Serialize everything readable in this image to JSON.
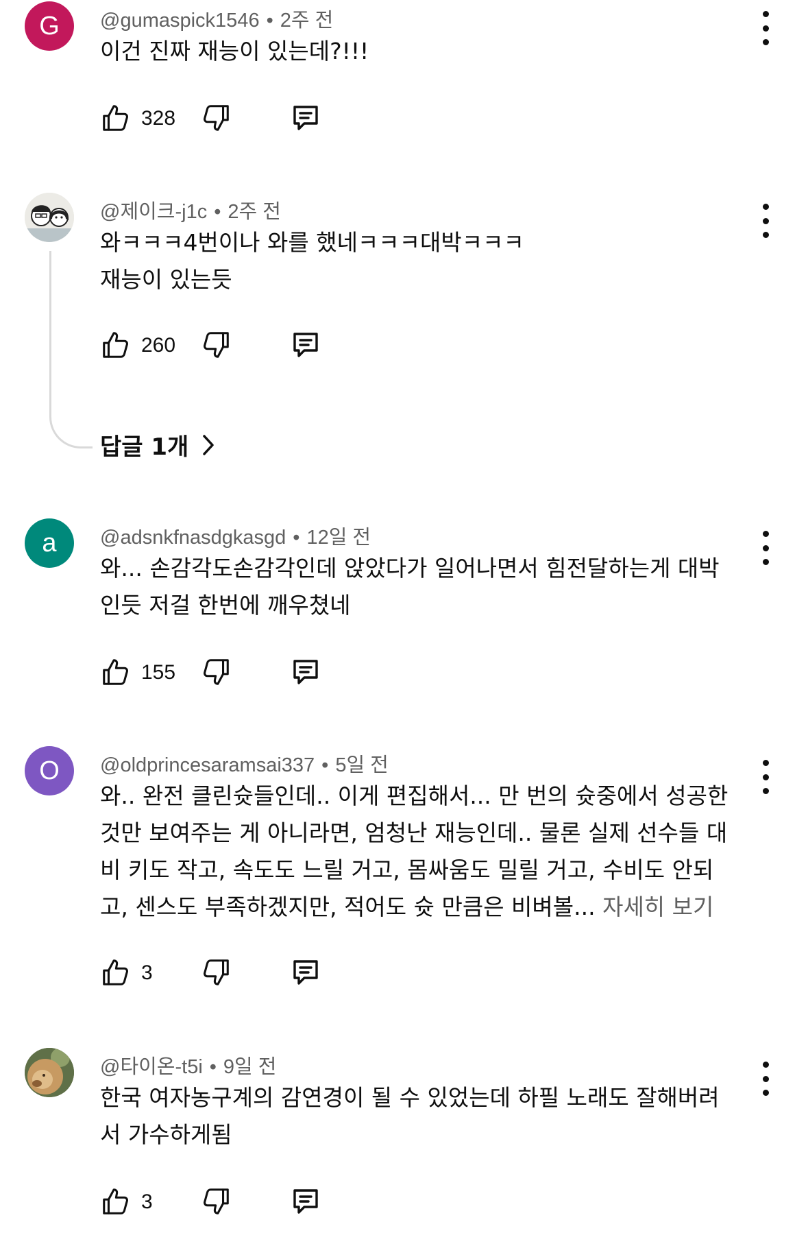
{
  "comments": [
    {
      "handle": "@gumaspick1546",
      "time": "2주 전",
      "avatar": {
        "type": "letter",
        "letter": "G",
        "color": "#c2185b"
      },
      "lines": [
        "이건 진짜 재능이 있는데?!!!"
      ],
      "more": "",
      "likes": "328"
    },
    {
      "handle": "@제이크-j1c",
      "time": "2주 전",
      "avatar": {
        "type": "image",
        "description": "illustrated couple"
      },
      "lines": [
        "와ㅋㅋㅋ4번이나 와를 했네ㅋㅋㅋ대박ㅋㅋㅋ",
        "재능이 있는듯"
      ],
      "more": "",
      "likes": "260",
      "replies_label": "답글 1개"
    },
    {
      "handle": "@adsnkfnasdgkasgd",
      "time": "12일 전",
      "avatar": {
        "type": "letter",
        "letter": "a",
        "color": "#00897b"
      },
      "lines": [
        "와... 손감각도손감각인데 앉았다가 일어나면서 힘전달하는게 대박",
        "인듯 저걸 한번에 깨우쳤네"
      ],
      "more": "",
      "likes": "155"
    },
    {
      "handle": "@oldprincesaramsai337",
      "time": "5일 전",
      "avatar": {
        "type": "letter",
        "letter": "O",
        "color": "#7e57c2"
      },
      "lines": [
        "와.. 완전 클린슛들인데.. 이게 편집해서... 만 번의 슛중에서 성공한",
        "것만 보여주는 게 아니라면, 엄청난 재능인데..  물론 실제 선수들 대",
        "비 키도 작고, 속도도 느릴 거고, 몸싸움도 밀릴 거고, 수비도 안되",
        "고, 센스도 부족하겠지만, 적어도 슛 만큼은 비벼볼... "
      ],
      "more": "자세히 보기",
      "likes": "3"
    },
    {
      "handle": "@타이온-t5i",
      "time": "9일 전",
      "avatar": {
        "type": "image",
        "description": "lion"
      },
      "lines": [
        "한국 여자농구계의 감연경이 될 수 있었는데 하필 노래도 잘해버려",
        "서 가수하게됨"
      ],
      "more": "",
      "likes": "3"
    }
  ],
  "colors": {
    "text": "#0f0f0f",
    "secondary": "#606060",
    "thread": "#d9d9d9"
  },
  "icons": [
    "thumb-up-icon",
    "thumb-down-icon",
    "reply-icon",
    "more-vert-icon",
    "chevron-right-icon"
  ]
}
